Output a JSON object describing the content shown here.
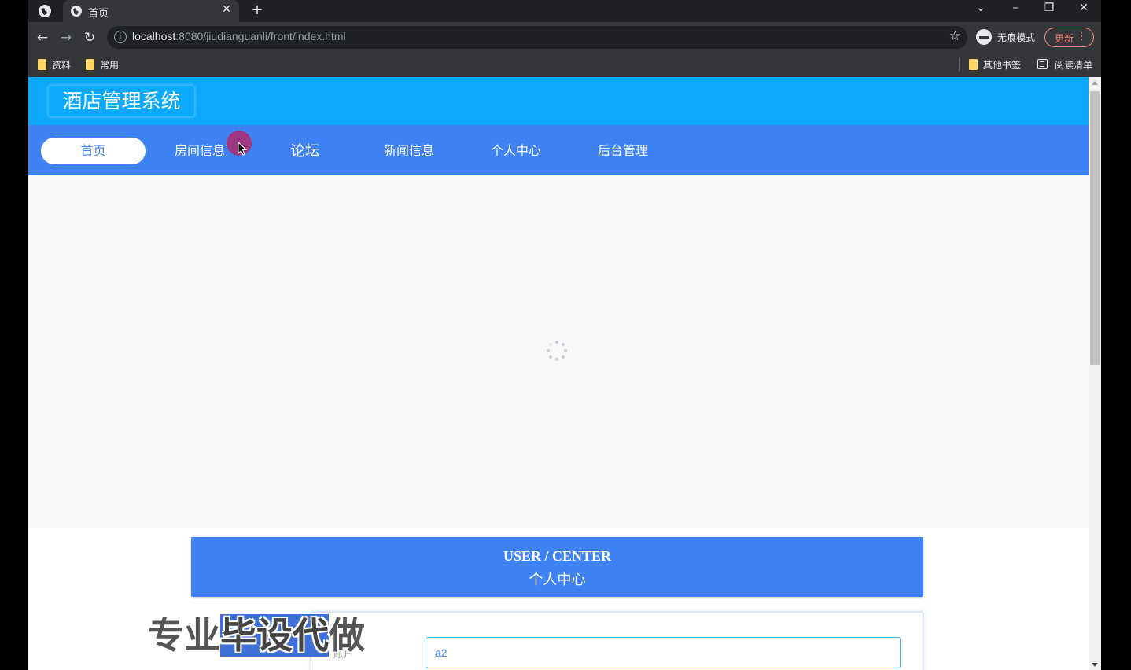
{
  "browser": {
    "tab_title": "首页",
    "url_host": "localhost",
    "url_path": ":8080/jiudianguanli/front/index.html",
    "incognito_label": "无痕模式",
    "update_label": "更新",
    "bookmarks_left": [
      {
        "label": "资料"
      },
      {
        "label": "常用"
      }
    ],
    "bookmarks_right": [
      {
        "label": "其他书签"
      },
      {
        "label": "阅读清单"
      }
    ]
  },
  "site": {
    "title": "酒店管理系统",
    "nav": [
      {
        "label": "首页",
        "active": true
      },
      {
        "label": "房间信息"
      },
      {
        "label": "论坛"
      },
      {
        "label": "新闻信息"
      },
      {
        "label": "个人中心"
      },
      {
        "label": "后台管理"
      }
    ]
  },
  "user_center": {
    "title_en": "USER / CENTER",
    "title_cn": "个人中心"
  },
  "form": {
    "account_label": "账户",
    "account_value": "a2"
  },
  "watermark": {
    "text_a": "专业",
    "text_b": "毕设代",
    "text_c": "做"
  },
  "colors": {
    "header_bg": "#0aa9fb",
    "nav_bg": "#3f82f3",
    "accent": "#3f82f3"
  }
}
